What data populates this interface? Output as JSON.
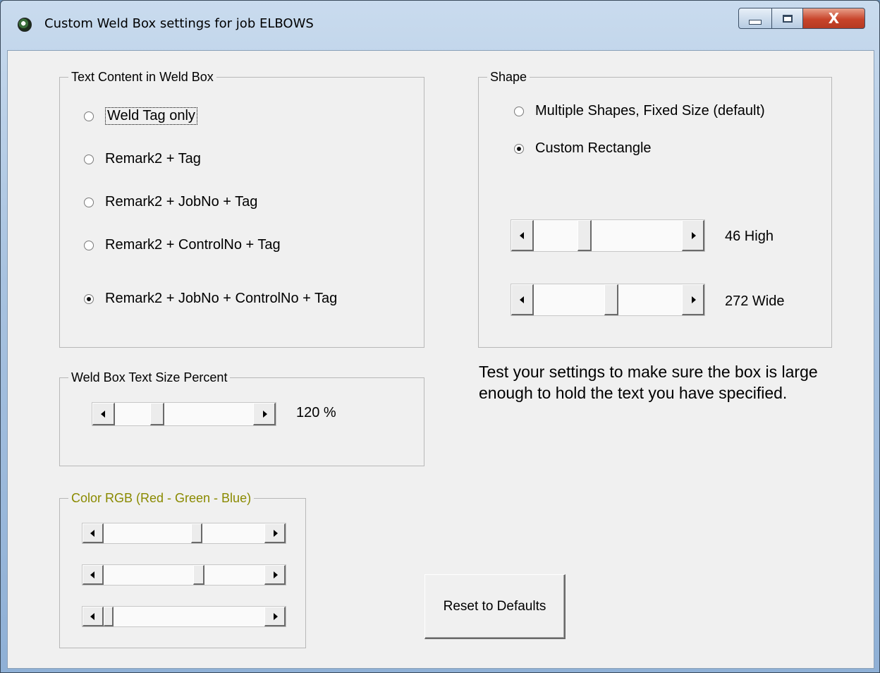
{
  "window": {
    "title": "Custom Weld Box settings for job ELBOWS",
    "close_glyph": "X"
  },
  "text_content": {
    "label": "Text Content in Weld Box",
    "options": [
      {
        "label": "Weld Tag only",
        "selected": false
      },
      {
        "label": "Remark2  + Tag",
        "selected": false
      },
      {
        "label": "Remark2  + JobNo +  Tag",
        "selected": false
      },
      {
        "label": "Remark2  + ControlNo +  Tag",
        "selected": false
      },
      {
        "label": "Remark2  + JobNo + ControlNo +  Tag",
        "selected": true
      }
    ]
  },
  "text_size": {
    "label": "Weld Box Text Size Percent",
    "value_label": "120 %"
  },
  "color": {
    "label": "Color RGB  (Red - Green - Blue)"
  },
  "shape": {
    "label": "Shape",
    "options": [
      {
        "label": "Multiple Shapes, Fixed Size (default)",
        "selected": false
      },
      {
        "label": "Custom Rectangle",
        "selected": true
      }
    ],
    "height_label": "46 High",
    "width_label": "272 Wide"
  },
  "note": "Test your settings to make sure the box is large enough to hold the text you have specified.",
  "reset_button": "Reset to Defaults",
  "icons": {
    "app": "app-globe-icon",
    "minimize": "minimize-icon",
    "maximize": "maximize-icon",
    "close": "close-icon"
  }
}
